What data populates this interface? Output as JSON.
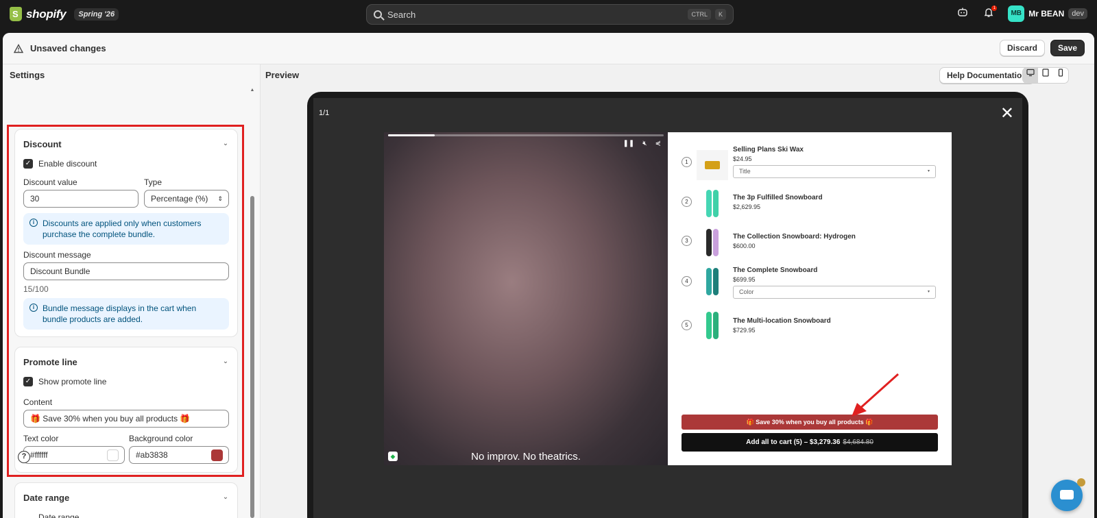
{
  "topbar": {
    "brand": "shopify",
    "edition": "Spring '26",
    "search_placeholder": "Search",
    "shortcut_ctrl": "CTRL",
    "shortcut_key": "K",
    "notification_count": "1",
    "avatar_initials": "MB",
    "account_name": "Mr BEAN",
    "store_badge": "dev"
  },
  "unsaved_bar": {
    "message": "Unsaved changes",
    "discard_label": "Discard",
    "save_label": "Save"
  },
  "settings": {
    "title": "Settings",
    "discount": {
      "title": "Discount",
      "enable_label": "Enable discount",
      "value_label": "Discount value",
      "value": "30",
      "type_label": "Type",
      "type_value": "Percentage (%)",
      "info_text": "Discounts are applied only when customers purchase the complete bundle.",
      "message_label": "Discount message",
      "message_value": "Discount Bundle",
      "char_count": "15/100",
      "bundle_info": "Bundle message displays in the cart when bundle products are added."
    },
    "promote_line": {
      "title": "Promote line",
      "show_label": "Show promote line",
      "content_label": "Content",
      "content_value": "🎁 Save 30% when you buy all products 🎁",
      "text_color_label": "Text color",
      "text_color_value": "#ffffff",
      "bg_color_label": "Background color",
      "bg_color_value": "#ab3838"
    },
    "date_range": {
      "title": "Date range",
      "option_label": "Date range"
    }
  },
  "preview": {
    "title": "Preview",
    "help_label": "Help Documentation",
    "slide_counter": "1/1",
    "video_subtitle": "No improv. No theatrics.",
    "video_progress": 0.17,
    "products": [
      {
        "num": "1",
        "name": "Selling Plans Ski Wax",
        "price": "$24.95",
        "select": "Title"
      },
      {
        "num": "2",
        "name": "The 3p Fulfilled Snowboard",
        "price": "$2,629.95"
      },
      {
        "num": "3",
        "name": "The Collection Snowboard: Hydrogen",
        "price": "$600.00"
      },
      {
        "num": "4",
        "name": "The Complete Snowboard",
        "price": "$699.95",
        "select": "Color"
      },
      {
        "num": "5",
        "name": "The Multi-location Snowboard",
        "price": "$729.95"
      }
    ],
    "promo_text": "🎁 Save 30% when you buy all products 🎁",
    "cart_label": "Add all to cart (5) – $3,279.36",
    "cart_original_price": "$4,684.80"
  },
  "colors": {
    "promo_bg": "#ab3838",
    "promo_text": "#ffffff",
    "annotation_red": "#e02020",
    "avatar": "#36e2c7"
  }
}
